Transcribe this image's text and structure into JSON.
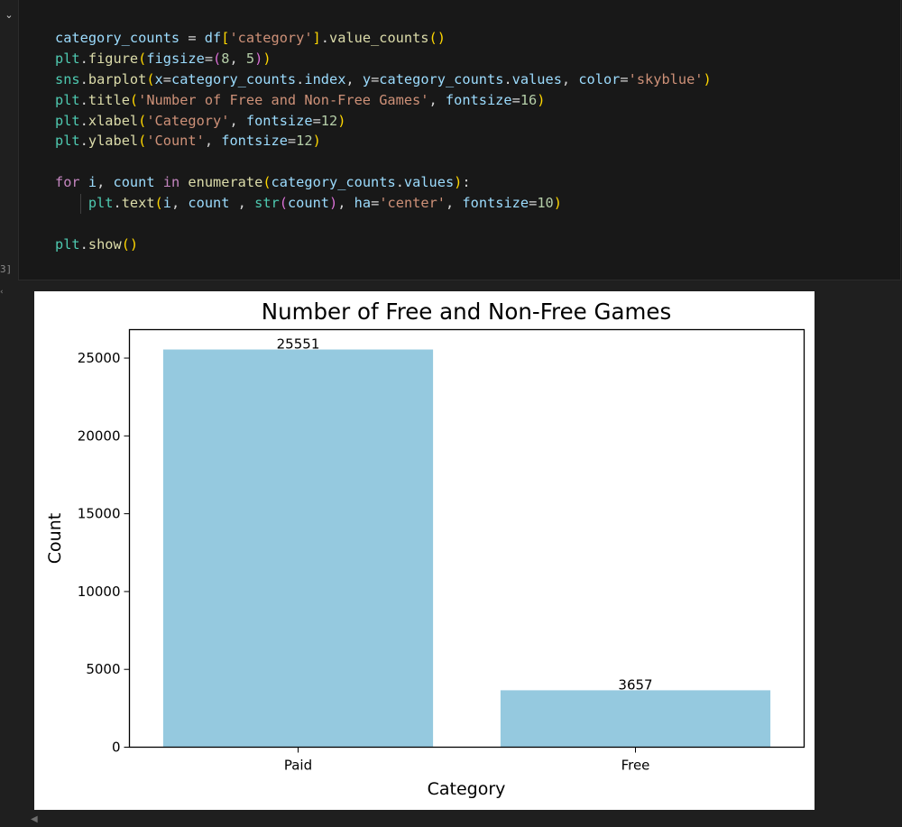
{
  "cell": {
    "exec_count": "3]",
    "code_lines": [
      [
        {
          "t": "category_counts",
          "c": "var"
        },
        {
          "t": " = ",
          "c": "op"
        },
        {
          "t": "df",
          "c": "var"
        },
        {
          "t": "[",
          "c": "br"
        },
        {
          "t": "'category'",
          "c": "str"
        },
        {
          "t": "]",
          "c": "br"
        },
        {
          "t": ".",
          "c": "op"
        },
        {
          "t": "value_counts",
          "c": "fn"
        },
        {
          "t": "()",
          "c": "br"
        }
      ],
      [
        {
          "t": "plt",
          "c": "bi"
        },
        {
          "t": ".",
          "c": "op"
        },
        {
          "t": "figure",
          "c": "fn"
        },
        {
          "t": "(",
          "c": "br"
        },
        {
          "t": "figsize",
          "c": "var"
        },
        {
          "t": "=",
          "c": "op"
        },
        {
          "t": "(",
          "c": "br2"
        },
        {
          "t": "8",
          "c": "num"
        },
        {
          "t": ", ",
          "c": "op"
        },
        {
          "t": "5",
          "c": "num"
        },
        {
          "t": ")",
          "c": "br2"
        },
        {
          "t": ")",
          "c": "br"
        }
      ],
      [
        {
          "t": "sns",
          "c": "bi"
        },
        {
          "t": ".",
          "c": "op"
        },
        {
          "t": "barplot",
          "c": "fn"
        },
        {
          "t": "(",
          "c": "br"
        },
        {
          "t": "x",
          "c": "var"
        },
        {
          "t": "=",
          "c": "op"
        },
        {
          "t": "category_counts",
          "c": "var"
        },
        {
          "t": ".",
          "c": "op"
        },
        {
          "t": "index",
          "c": "var"
        },
        {
          "t": ", ",
          "c": "op"
        },
        {
          "t": "y",
          "c": "var"
        },
        {
          "t": "=",
          "c": "op"
        },
        {
          "t": "category_counts",
          "c": "var"
        },
        {
          "t": ".",
          "c": "op"
        },
        {
          "t": "values",
          "c": "var"
        },
        {
          "t": ", ",
          "c": "op"
        },
        {
          "t": "color",
          "c": "var"
        },
        {
          "t": "=",
          "c": "op"
        },
        {
          "t": "'skyblue'",
          "c": "str"
        },
        {
          "t": ")",
          "c": "br"
        }
      ],
      [
        {
          "t": "plt",
          "c": "bi"
        },
        {
          "t": ".",
          "c": "op"
        },
        {
          "t": "title",
          "c": "fn"
        },
        {
          "t": "(",
          "c": "br"
        },
        {
          "t": "'Number of Free and Non-Free Games'",
          "c": "str"
        },
        {
          "t": ", ",
          "c": "op"
        },
        {
          "t": "fontsize",
          "c": "var"
        },
        {
          "t": "=",
          "c": "op"
        },
        {
          "t": "16",
          "c": "num"
        },
        {
          "t": ")",
          "c": "br"
        }
      ],
      [
        {
          "t": "plt",
          "c": "bi"
        },
        {
          "t": ".",
          "c": "op"
        },
        {
          "t": "xlabel",
          "c": "fn"
        },
        {
          "t": "(",
          "c": "br"
        },
        {
          "t": "'Category'",
          "c": "str"
        },
        {
          "t": ", ",
          "c": "op"
        },
        {
          "t": "fontsize",
          "c": "var"
        },
        {
          "t": "=",
          "c": "op"
        },
        {
          "t": "12",
          "c": "num"
        },
        {
          "t": ")",
          "c": "br"
        }
      ],
      [
        {
          "t": "plt",
          "c": "bi"
        },
        {
          "t": ".",
          "c": "op"
        },
        {
          "t": "ylabel",
          "c": "fn"
        },
        {
          "t": "(",
          "c": "br"
        },
        {
          "t": "'Count'",
          "c": "str"
        },
        {
          "t": ", ",
          "c": "op"
        },
        {
          "t": "fontsize",
          "c": "var"
        },
        {
          "t": "=",
          "c": "op"
        },
        {
          "t": "12",
          "c": "num"
        },
        {
          "t": ")",
          "c": "br"
        }
      ],
      [],
      [
        {
          "t": "for",
          "c": "kw"
        },
        {
          "t": " ",
          "c": "op"
        },
        {
          "t": "i",
          "c": "var"
        },
        {
          "t": ", ",
          "c": "op"
        },
        {
          "t": "count",
          "c": "var"
        },
        {
          "t": " ",
          "c": "op"
        },
        {
          "t": "in",
          "c": "kw"
        },
        {
          "t": " ",
          "c": "op"
        },
        {
          "t": "enumerate",
          "c": "fn"
        },
        {
          "t": "(",
          "c": "br"
        },
        {
          "t": "category_counts",
          "c": "var"
        },
        {
          "t": ".",
          "c": "op"
        },
        {
          "t": "values",
          "c": "var"
        },
        {
          "t": ")",
          "c": "br"
        },
        {
          "t": ":",
          "c": "op"
        }
      ],
      [
        {
          "t": "    ",
          "c": "op"
        },
        {
          "t": "plt",
          "c": "bi"
        },
        {
          "t": ".",
          "c": "op"
        },
        {
          "t": "text",
          "c": "fn"
        },
        {
          "t": "(",
          "c": "br"
        },
        {
          "t": "i",
          "c": "var"
        },
        {
          "t": ", ",
          "c": "op"
        },
        {
          "t": "count",
          "c": "var"
        },
        {
          "t": " , ",
          "c": "op"
        },
        {
          "t": "str",
          "c": "bi"
        },
        {
          "t": "(",
          "c": "br2"
        },
        {
          "t": "count",
          "c": "var"
        },
        {
          "t": ")",
          "c": "br2"
        },
        {
          "t": ", ",
          "c": "op"
        },
        {
          "t": "ha",
          "c": "var"
        },
        {
          "t": "=",
          "c": "op"
        },
        {
          "t": "'center'",
          "c": "str"
        },
        {
          "t": ", ",
          "c": "op"
        },
        {
          "t": "fontsize",
          "c": "var"
        },
        {
          "t": "=",
          "c": "op"
        },
        {
          "t": "10",
          "c": "num"
        },
        {
          "t": ")",
          "c": "br"
        }
      ],
      [],
      [
        {
          "t": "plt",
          "c": "bi"
        },
        {
          "t": ".",
          "c": "op"
        },
        {
          "t": "show",
          "c": "fn"
        },
        {
          "t": "()",
          "c": "br"
        }
      ]
    ]
  },
  "chart_data": {
    "type": "bar",
    "title": "Number of Free and Non-Free Games",
    "xlabel": "Category",
    "ylabel": "Count",
    "categories": [
      "Paid",
      "Free"
    ],
    "values": [
      25551,
      3657
    ],
    "data_labels": [
      "25551",
      "3657"
    ],
    "ylim": [
      0,
      26828
    ],
    "yticks": [
      0,
      5000,
      10000,
      15000,
      20000,
      25000
    ],
    "ytick_labels": [
      "0",
      "5000",
      "10000",
      "15000",
      "20000",
      "25000"
    ],
    "bar_color": "#95c9df",
    "grid": false,
    "legend": "none"
  }
}
